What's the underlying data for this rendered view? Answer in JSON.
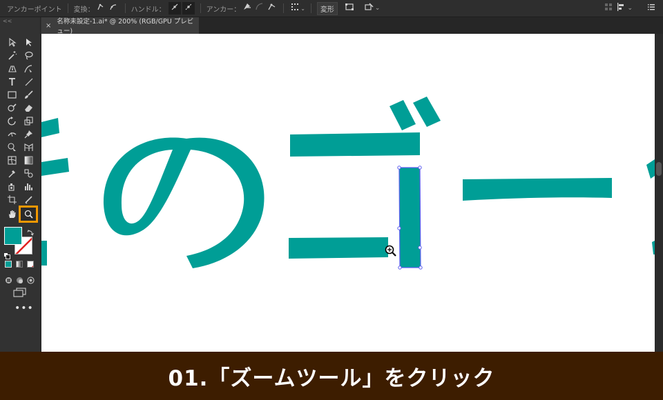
{
  "control_bar": {
    "anchor_point_label": "アンカーポイント",
    "transform_label": "変換：",
    "handle_label": "ハンドル：",
    "anchor_label": "アンカー：",
    "transform_button": "変形"
  },
  "document": {
    "tab_title": "名称未設定-1.ai* @ 200% (RGB/GPU プレビュー)",
    "close_glyph": "×"
  },
  "tools": {
    "active_tool": "zoom-tool",
    "fill_color": "#009e96",
    "stroke": "none"
  },
  "canvas": {
    "art_color": "#009e96",
    "selection_color": "#5c5cf0",
    "text_characters": [
      "春",
      "の",
      "ゴ",
      "ー"
    ]
  },
  "caption": {
    "text": "01.「ズームツール」をクリック",
    "background": "#3d1d00"
  },
  "colors": {
    "accent_highlight": "#f39800"
  }
}
